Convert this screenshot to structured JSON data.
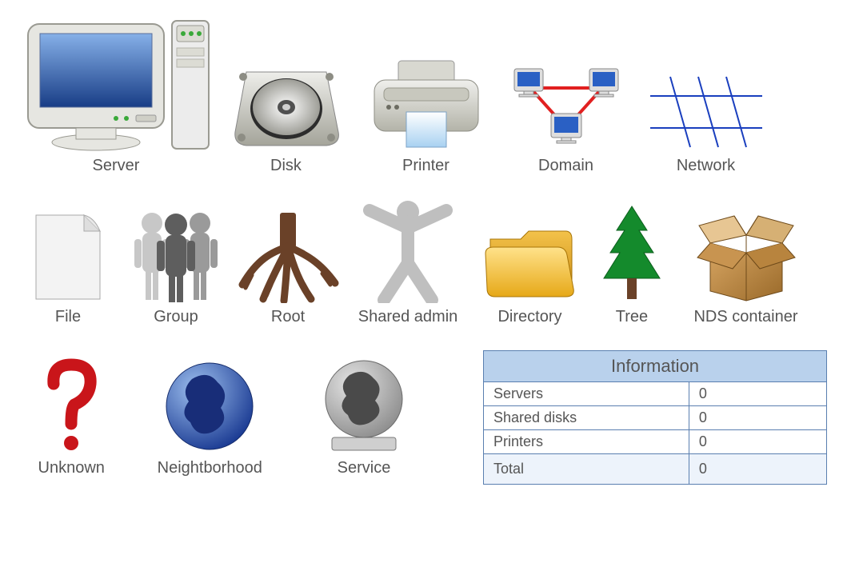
{
  "row1": [
    {
      "label": "Server"
    },
    {
      "label": "Disk"
    },
    {
      "label": "Printer"
    },
    {
      "label": "Domain"
    },
    {
      "label": "Network"
    }
  ],
  "row2": [
    {
      "label": "File"
    },
    {
      "label": "Group"
    },
    {
      "label": "Root"
    },
    {
      "label": "Shared admin"
    },
    {
      "label": "Directory"
    },
    {
      "label": "Tree"
    },
    {
      "label": "NDS container"
    }
  ],
  "row3_items": [
    {
      "label": "Unknown"
    },
    {
      "label": "Neightborhood"
    },
    {
      "label": "Service"
    }
  ],
  "info": {
    "title": "Information",
    "rows": [
      {
        "key": "Servers",
        "value": "0"
      },
      {
        "key": "Shared disks",
        "value": "0"
      },
      {
        "key": "Printers",
        "value": "0"
      }
    ],
    "total_key": "Total",
    "total_value": "0"
  }
}
